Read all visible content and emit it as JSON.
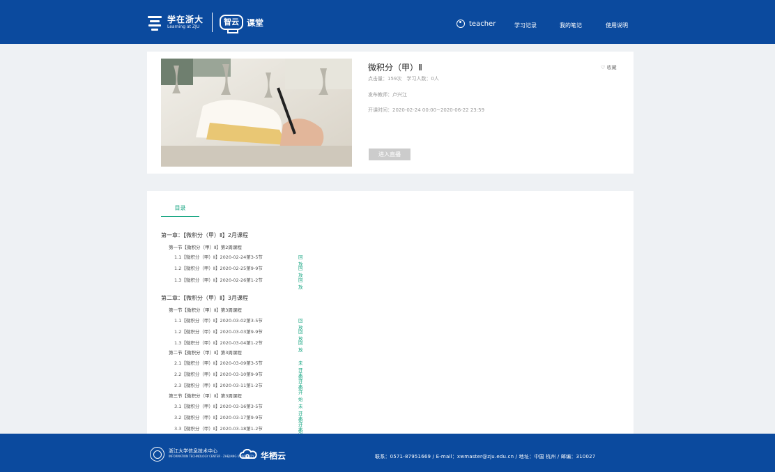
{
  "header": {
    "logo_text": "学在浙大",
    "logo_subtext": "Learning at ZJU",
    "badge_text": "智云",
    "badge_suffix": "课堂",
    "user_name": "teacher",
    "nav": [
      "学习记录",
      "我的笔记",
      "使用说明"
    ]
  },
  "course": {
    "title": "微积分（甲）Ⅱ",
    "stats": "点击量：159次　学习人数：0人",
    "teacher": "发布教师：卢兴江",
    "time": "开课时间：2020-02-24 00:00~2020-06-22 23:59",
    "favorite": "♡ 收藏",
    "enter_button": "进入直播"
  },
  "catalog": {
    "tab_label": "目录",
    "rows": [
      {
        "type": "chapter",
        "text": "第一章：【微积分（甲）Ⅱ】2月课程"
      },
      {
        "type": "section",
        "text": "第一节【微积分（甲）Ⅱ】第2周课程"
      },
      {
        "type": "lesson",
        "text": "1.1【微积分（甲）Ⅱ】2020-02-24第3-5节",
        "status": "回放"
      },
      {
        "type": "lesson",
        "text": "1.2【微积分（甲）Ⅱ】2020-02-25第9-9节",
        "status": "回放"
      },
      {
        "type": "lesson",
        "text": "1.3【微积分（甲）Ⅱ】2020-02-26第1-2节",
        "status": "回放"
      },
      {
        "type": "chapter",
        "text": "第二章：【微积分（甲）Ⅱ】3月课程"
      },
      {
        "type": "section",
        "text": "第一节【微积分（甲）Ⅱ】第3周课程"
      },
      {
        "type": "lesson",
        "text": "1.1【微积分（甲）Ⅱ】2020-03-02第3-5节",
        "status": "回放"
      },
      {
        "type": "lesson",
        "text": "1.2【微积分（甲）Ⅱ】2020-03-03第9-9节",
        "status": "回放"
      },
      {
        "type": "lesson",
        "text": "1.3【微积分（甲）Ⅱ】2020-03-04第1-2节",
        "status": "回放"
      },
      {
        "type": "section",
        "text": "第二节【微积分（甲）Ⅱ】第3周课程"
      },
      {
        "type": "lesson",
        "text": "2.1【微积分（甲）Ⅱ】2020-03-09第3-5节",
        "status": "未开始"
      },
      {
        "type": "lesson",
        "text": "2.2【微积分（甲）Ⅱ】2020-03-10第9-9节",
        "status": "未开始"
      },
      {
        "type": "lesson",
        "text": "2.3【微积分（甲）Ⅱ】2020-03-11第1-2节",
        "status": "未开始"
      },
      {
        "type": "section",
        "text": "第三节【微积分（甲）Ⅱ】第3周课程"
      },
      {
        "type": "lesson",
        "text": "3.1【微积分（甲）Ⅱ】2020-03-16第3-5节",
        "status": "未开始"
      },
      {
        "type": "lesson",
        "text": "3.2【微积分（甲）Ⅱ】2020-03-17第9-9节",
        "status": "未开始"
      },
      {
        "type": "lesson",
        "text": "3.3【微积分（甲）Ⅱ】2020-03-18第1-2节",
        "status": "未开始"
      }
    ]
  },
  "footer": {
    "org_name": "浙江大学信息技术中心",
    "org_subtitle": "INFORMATION TECHNOLOGY CENTER · ZHEJIANG UNIVERSITY",
    "brand": "华栖云",
    "contact": "联系：0571-87951669 / E-mail：xwmaster@zju.edu.cn / 地址：中国 杭州 / 邮编：310027"
  },
  "colors": {
    "header": "#0b4a9e",
    "accent": "#1ba784",
    "page_bg": "#eef1f4"
  },
  "icons": [
    "logo-icon",
    "user-icon",
    "heart-icon",
    "university-seal-icon",
    "cloud-logo-icon"
  ]
}
